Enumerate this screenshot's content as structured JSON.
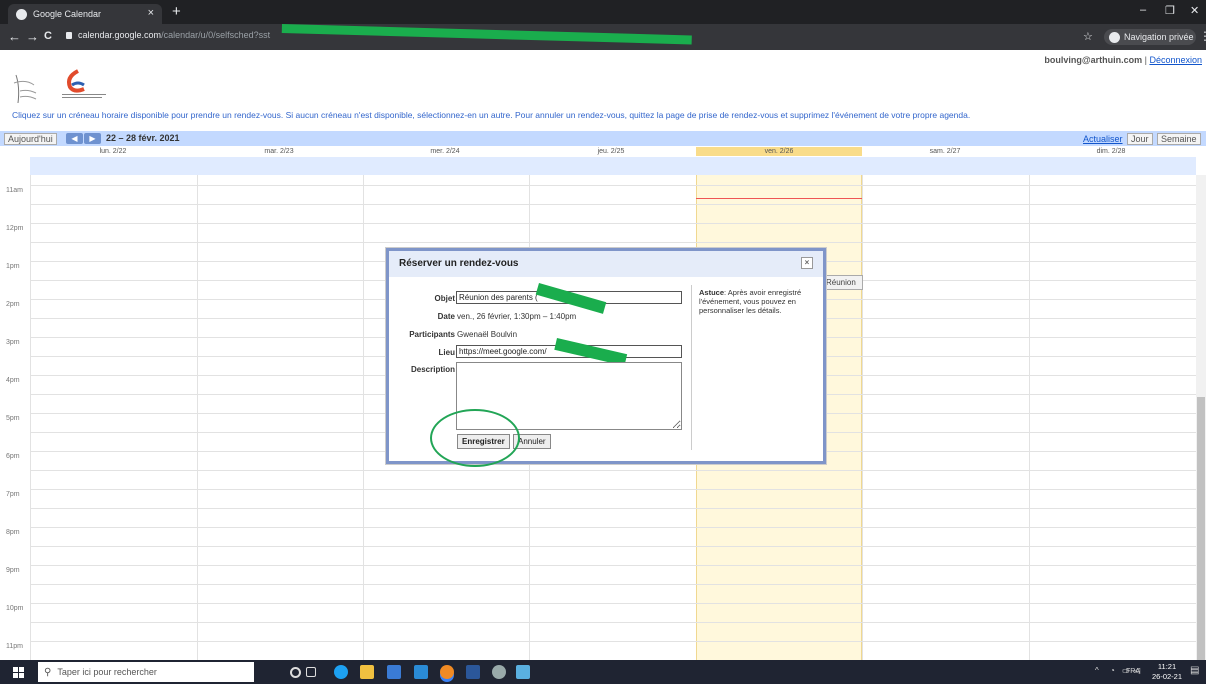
{
  "browser": {
    "tab_title": "Google Calendar",
    "tab_close": "×",
    "new_tab": "+",
    "url_host": "calendar.google.com",
    "url_path": "/calendar/u/0/selfsched?sst",
    "url_tail": "...",
    "incognito_label": "Navigation privée",
    "star": "☆",
    "menu": "⋮",
    "back": "←",
    "forward": "→",
    "reload": "C",
    "minimize": "–",
    "maximize": "❐",
    "close": "✕"
  },
  "header": {
    "user_email": "boulving@arthuin.com",
    "separator": " | ",
    "logout": "Déconnexion",
    "instructions": "Cliquez sur un créneau horaire disponible pour prendre un rendez-vous. Si aucun créneau n'est disponible, sélectionnez-en un autre. Pour annuler un rendez-vous, quittez la page de prise de rendez-vous et supprimez l'événement de votre propre agenda."
  },
  "toolbar": {
    "today": "Aujourd'hui",
    "prev": "◀",
    "next": "▶",
    "date_range": "22 – 28 févr. 2021",
    "refresh": "Actualiser",
    "day_view": "Jour",
    "week_view": "Semaine"
  },
  "days": [
    "lun. 2/22",
    "mar. 2/23",
    "mer. 2/24",
    "jeu. 2/25",
    "ven. 2/26",
    "sam. 2/27",
    "dim. 2/28"
  ],
  "hours": [
    "11am",
    "12pm",
    "1pm",
    "2pm",
    "3pm",
    "4pm",
    "5pm",
    "6pm",
    "7pm",
    "8pm",
    "9pm",
    "10pm",
    "11pm"
  ],
  "event": {
    "label": "Réunion"
  },
  "dialog": {
    "title": "Réserver un rendez-vous",
    "close": "×",
    "subject_label": "Objet",
    "subject_value": "Réunion des parents (",
    "date_label": "Date",
    "date_value": "ven., 26 février, 1:30pm – 1:40pm",
    "participants_label": "Participants",
    "participants_value": "Gwenaël Boulvin",
    "location_label": "Lieu",
    "location_value": "https://meet.google.com/",
    "description_label": "Description",
    "description_value": "",
    "tip_bold": "Astuce",
    "tip_text": ": Après avoir enregistré l'événement, vous pouvez en personnaliser les détails.",
    "save": "Enregistrer",
    "cancel": "Annuler"
  },
  "taskbar": {
    "search_placeholder": "Taper ici pour rechercher",
    "language": "FRA",
    "time": "11:21",
    "date": "26-02-21"
  },
  "colors": {
    "redaction": "#1aad4d",
    "toolbar_bg": "#c3d9ff",
    "today_col": "#fff8dc",
    "dialog_border": "#7f95c9"
  }
}
